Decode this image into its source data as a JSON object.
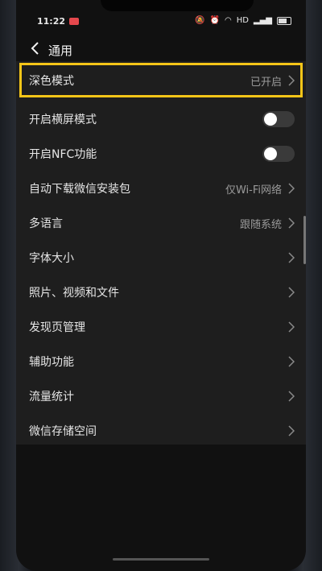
{
  "status_bar": {
    "time": "11:22",
    "indicators": "HD"
  },
  "header": {
    "title": "通用",
    "back_icon": "chevron-left-icon"
  },
  "settings": [
    {
      "label": "深色模式",
      "value": "已开启",
      "type": "chevron",
      "highlighted": true
    },
    {
      "label": "开启横屏模式",
      "type": "toggle",
      "enabled": false
    },
    {
      "label": "开启NFC功能",
      "type": "toggle",
      "enabled": false
    },
    {
      "label": "自动下载微信安装包",
      "value": "仅Wi-Fi网络",
      "type": "chevron"
    },
    {
      "label": "多语言",
      "value": "跟随系统",
      "type": "chevron"
    },
    {
      "label": "字体大小",
      "type": "chevron"
    },
    {
      "label": "照片、视频和文件",
      "type": "chevron"
    },
    {
      "label": "发现页管理",
      "type": "chevron"
    },
    {
      "label": "辅助功能",
      "type": "chevron"
    },
    {
      "label": "流量统计",
      "type": "chevron"
    },
    {
      "label": "微信存储空间",
      "type": "chevron"
    }
  ],
  "colors": {
    "highlight": "#f5c518",
    "list_bg": "#1e1e1e",
    "page_bg": "#111111"
  }
}
